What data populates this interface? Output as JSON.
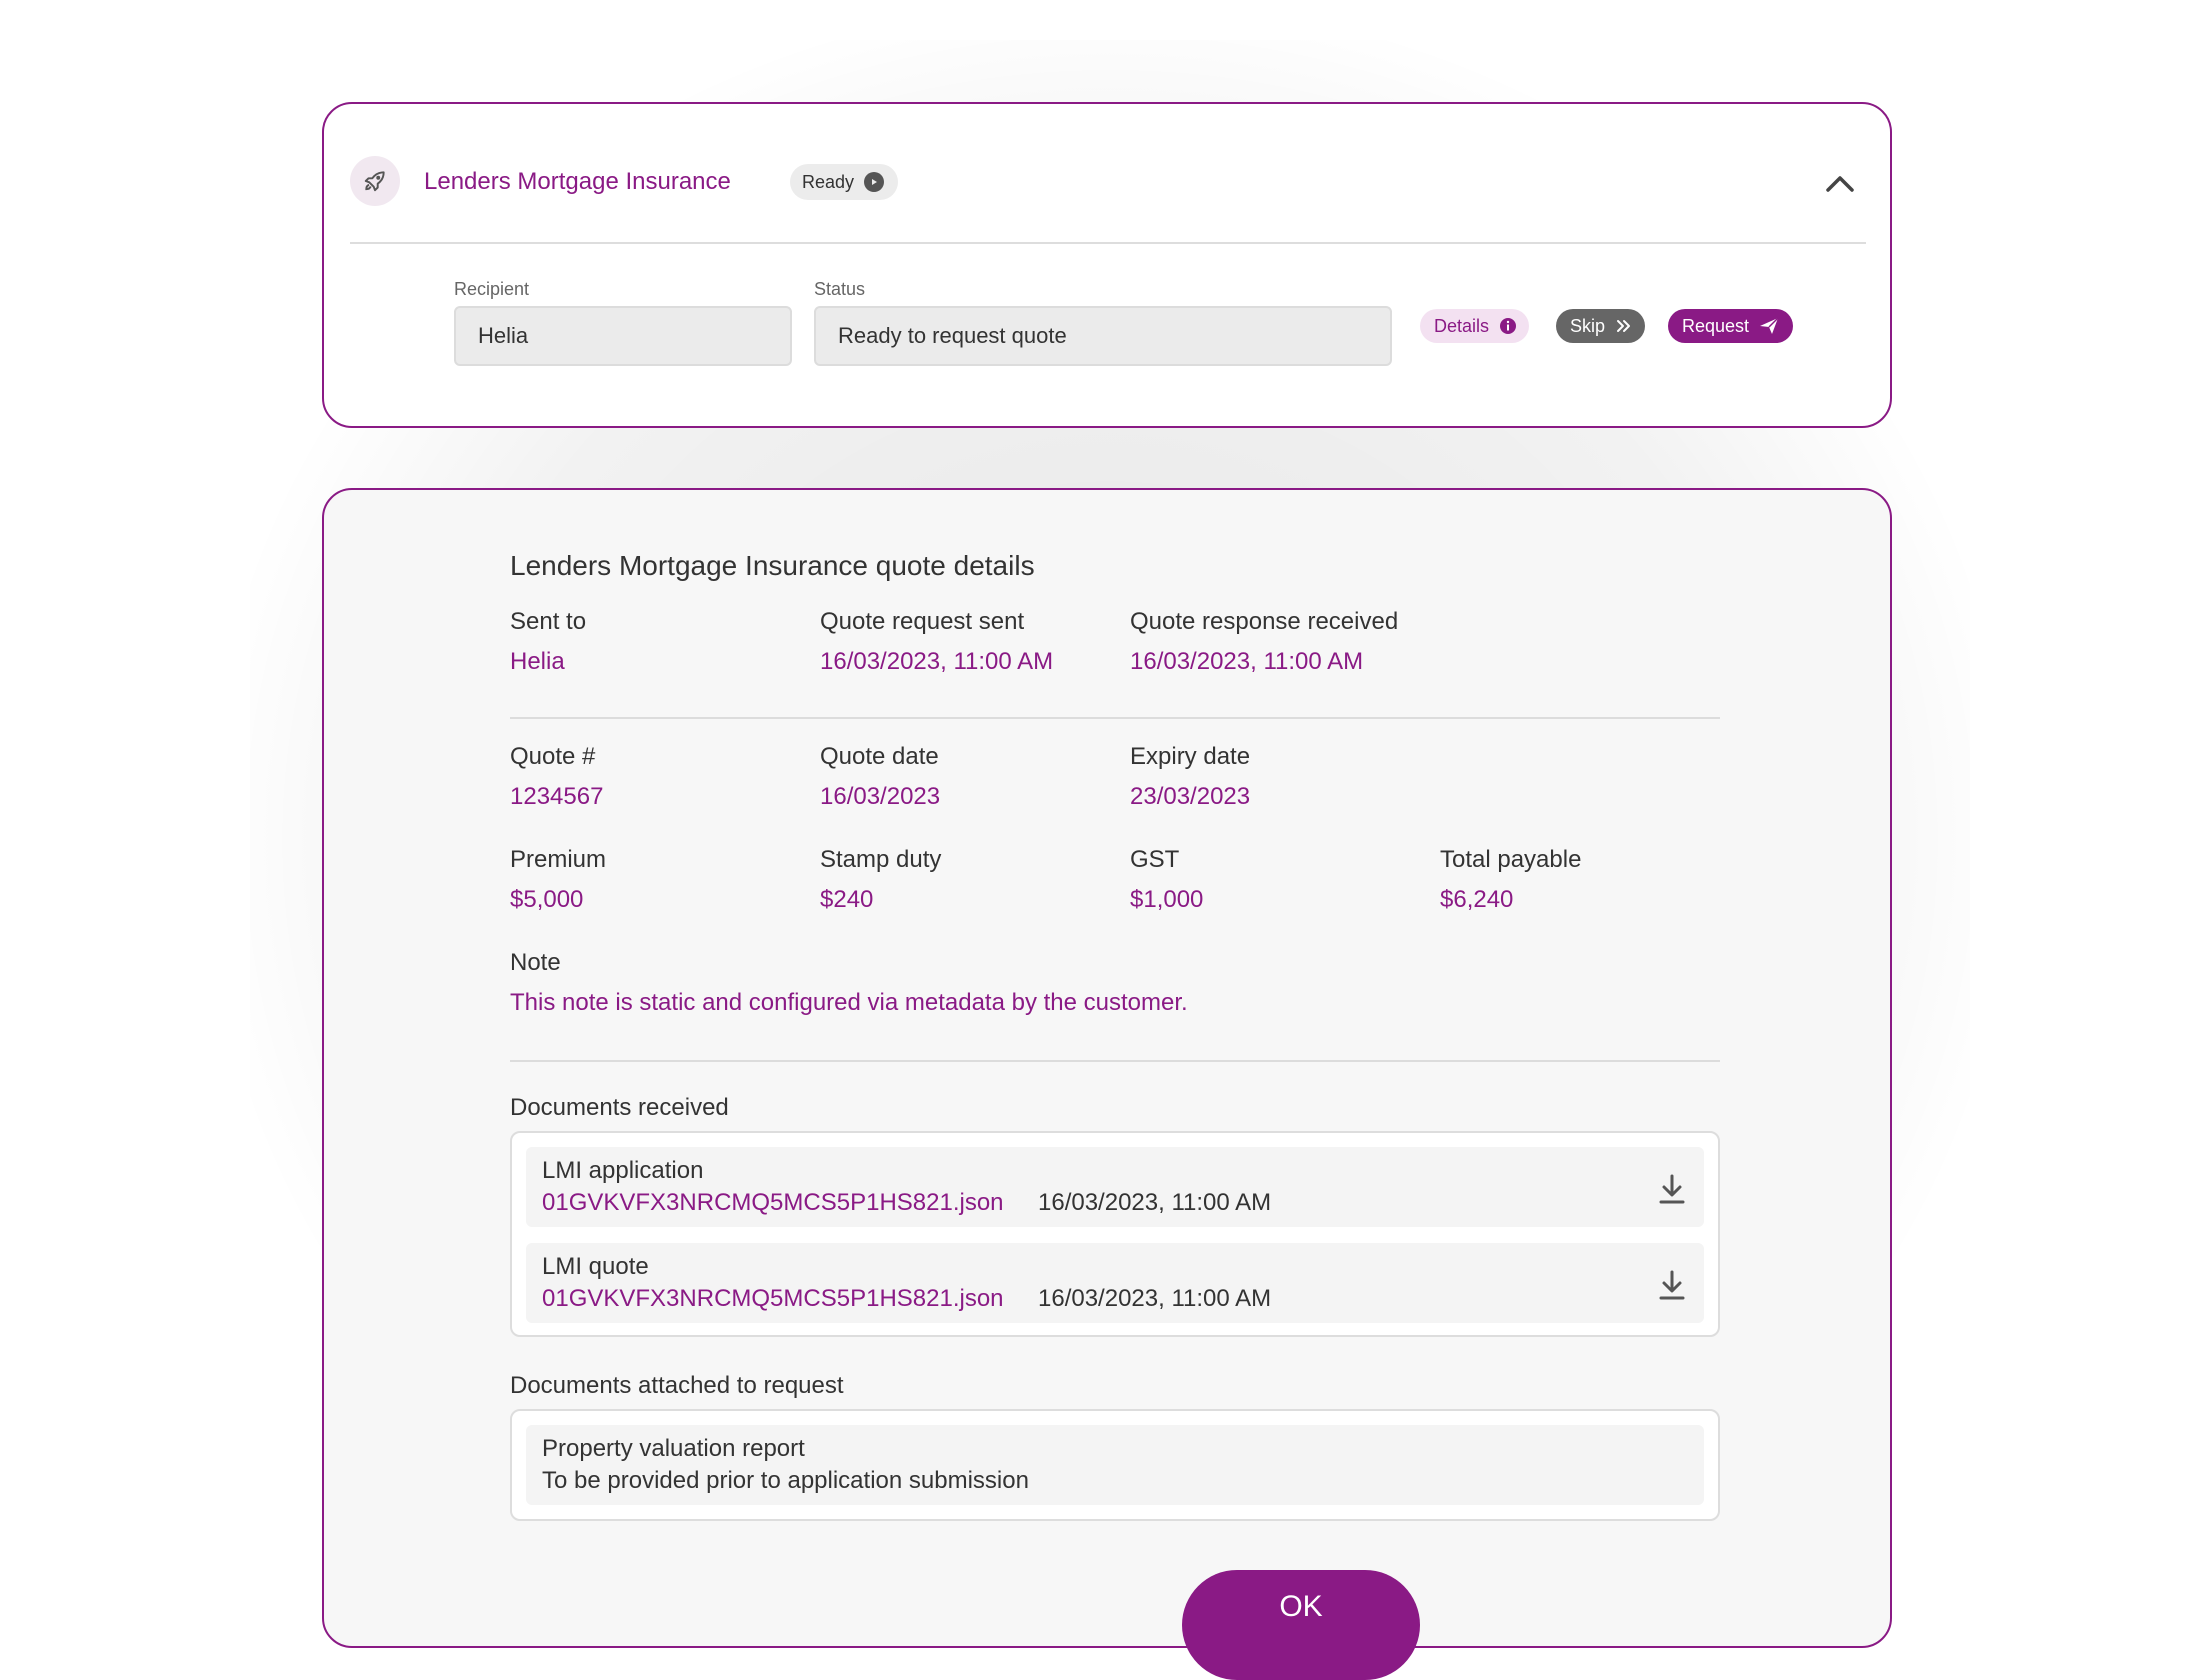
{
  "colors": {
    "accent": "#8a1a85",
    "card_border": "#8a1a85",
    "field_bg": "#ebebeb",
    "skip_bg": "#666666",
    "details_bg": "#f3e1f1"
  },
  "header": {
    "icon": "rocket-icon",
    "title": "Lenders Mortgage Insurance",
    "status_pill": "Ready",
    "status_icon": "play-circle-icon",
    "collapse_icon": "chevron-up-icon"
  },
  "form": {
    "recipient_label": "Recipient",
    "recipient_value": "Helia",
    "status_label": "Status",
    "status_value": "Ready to request quote"
  },
  "actions": {
    "details_label": "Details",
    "details_icon": "info-icon",
    "skip_label": "Skip",
    "skip_icon": "double-chevron-right-icon",
    "request_label": "Request",
    "request_icon": "send-icon"
  },
  "details": {
    "title": "Lenders Mortgage Insurance quote details",
    "sent_to": {
      "label": "Sent to",
      "value": "Helia"
    },
    "quote_request_sent": {
      "label": "Quote request sent",
      "value": "16/03/2023, 11:00 AM"
    },
    "quote_response_received": {
      "label": "Quote response received",
      "value": "16/03/2023, 11:00 AM"
    },
    "quote_number": {
      "label": "Quote #",
      "value": "1234567"
    },
    "quote_date": {
      "label": "Quote date",
      "value": "16/03/2023"
    },
    "expiry_date": {
      "label": "Expiry date",
      "value": "23/03/2023"
    },
    "premium": {
      "label": "Premium",
      "value": "$5,000"
    },
    "stamp_duty": {
      "label": "Stamp duty",
      "value": "$240"
    },
    "gst": {
      "label": "GST",
      "value": "$1,000"
    },
    "total_payable": {
      "label": "Total payable",
      "value": "$6,240"
    },
    "note": {
      "label": "Note",
      "value": "This note is static and configured via metadata by the customer."
    },
    "documents_received_label": "Documents received",
    "documents_received": [
      {
        "name": "LMI application",
        "file": "01GVKVFX3NRCMQ5MCS5P1HS821.json",
        "date": "16/03/2023, 11:00 AM",
        "icon": "download-icon"
      },
      {
        "name": "LMI quote",
        "file": "01GVKVFX3NRCMQ5MCS5P1HS821.json",
        "date": "16/03/2023, 11:00 AM",
        "icon": "download-icon"
      }
    ],
    "documents_attached_label": "Documents attached to request",
    "documents_attached": [
      {
        "name": "Property valuation report",
        "description": "To be provided prior to application submission"
      }
    ],
    "ok_label": "OK"
  }
}
